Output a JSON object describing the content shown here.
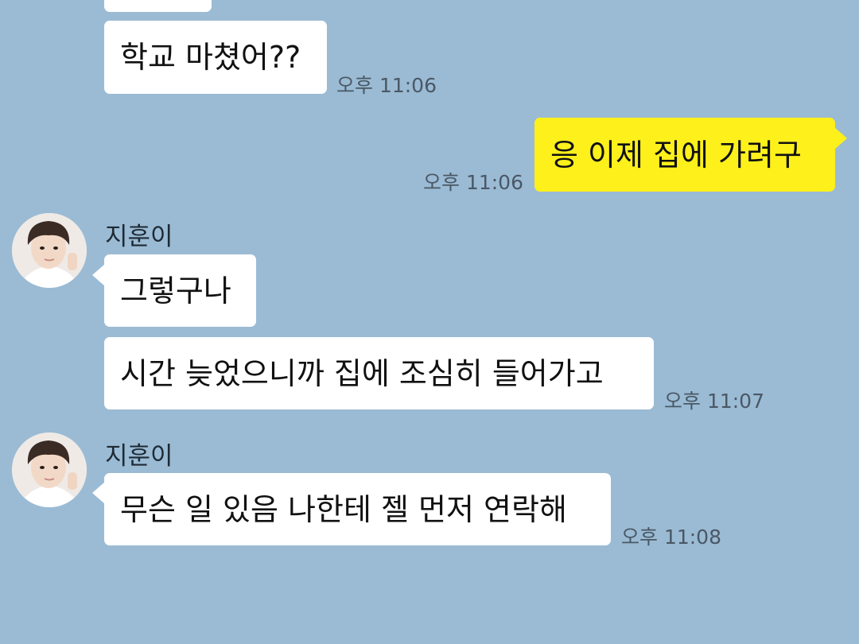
{
  "colors": {
    "background": "#9bbbd4",
    "incoming_bubble": "#ffffff",
    "outgoing_bubble": "#fef01b",
    "timestamp": "#4a5866"
  },
  "messages": [
    {
      "side": "incoming",
      "text": "",
      "time": ""
    },
    {
      "side": "incoming",
      "text": "학교 마쳤어??",
      "time": "오후 11:06"
    },
    {
      "side": "outgoing",
      "text": "응 이제 집에 가려구",
      "time": "오후 11:06"
    },
    {
      "side": "incoming",
      "sender": "지훈이",
      "avatar": "profile-photo",
      "text": "그렇구나",
      "time": ""
    },
    {
      "side": "incoming",
      "text": "시간 늦었으니까 집에 조심히 들어가고",
      "time": "오후 11:07"
    },
    {
      "side": "incoming",
      "sender": "지훈이",
      "avatar": "profile-photo",
      "text": "무슨 일 있음 나한테 젤 먼저 연락해",
      "time": "오후 11:08"
    }
  ]
}
